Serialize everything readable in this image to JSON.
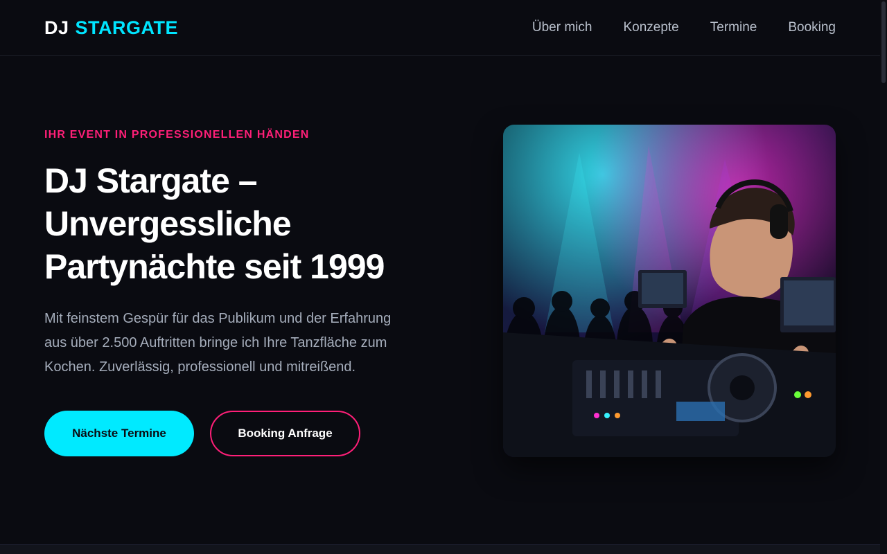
{
  "brand": {
    "part1": "DJ",
    "part2": "STARGATE"
  },
  "nav": {
    "items": [
      {
        "label": "Über mich"
      },
      {
        "label": "Konzepte"
      },
      {
        "label": "Termine"
      },
      {
        "label": "Booking"
      }
    ]
  },
  "hero": {
    "eyebrow": "IHR EVENT IN PROFESSIONELLEN HÄNDEN",
    "headline_lines": [
      "DJ Stargate –",
      "Unvergessliche",
      "Partynächte seit 1999"
    ],
    "lead_lines": [
      "Mit feinstem Gespür für das Publikum und der Erfahrung",
      "aus über 2.500 Auftritten bringe ich Ihre Tanzfläche zum",
      "Kochen. Zuverlässig, professionell und mitreißend."
    ],
    "primary_button": "Nächste Termine",
    "secondary_button": "Booking Anfrage"
  },
  "colors": {
    "background": "#0a0b11",
    "accent_cyan": "#00e5ff",
    "accent_pink": "#ff1f78"
  }
}
